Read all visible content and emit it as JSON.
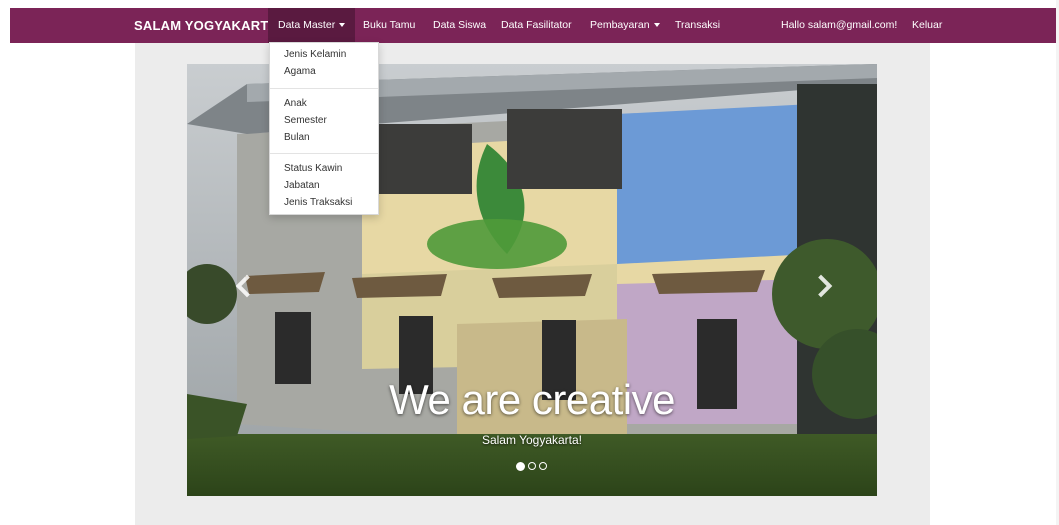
{
  "navbar": {
    "brand": "SALAM YOGYAKARTA",
    "items": [
      {
        "label": "Data Master"
      },
      {
        "label": "Buku Tamu"
      },
      {
        "label": "Data Siswa"
      },
      {
        "label": "Data Fasilitator"
      },
      {
        "label": "Pembayaran"
      },
      {
        "label": "Transaksi"
      }
    ],
    "user_label": "Hallo salam@gmail.com!",
    "logout_label": "Keluar",
    "color": "#7b2457"
  },
  "dropdown": {
    "groups": [
      [
        "Jenis Kelamin",
        "Agama"
      ],
      [
        "Anak",
        "Semester",
        "Bulan"
      ],
      [
        "Status Kawin",
        "Jabatan",
        "Jenis Traksaksi"
      ]
    ]
  },
  "carousel": {
    "title": "We are creative",
    "subtitle": "Salam Yogyakarta!",
    "slide_count": 3,
    "active_index": 0
  }
}
